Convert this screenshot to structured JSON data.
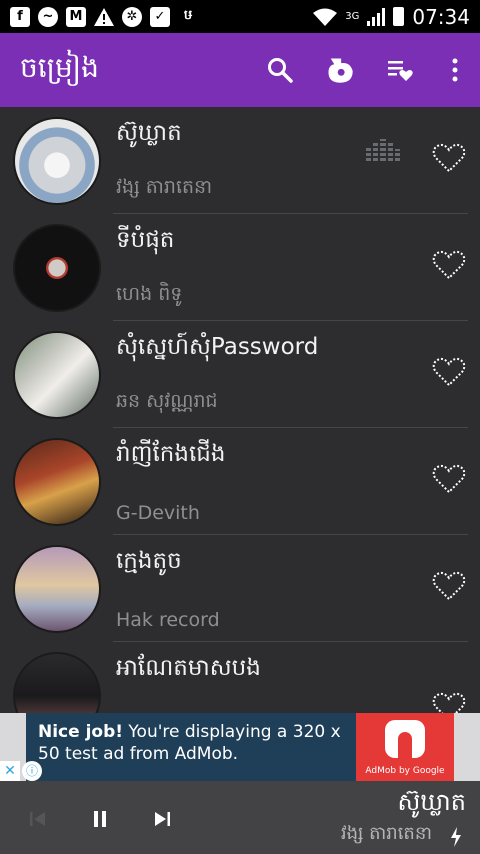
{
  "status_bar": {
    "network": "3G",
    "time": "07:34",
    "left_icons": [
      "facebook-icon",
      "messenger-icon",
      "gmail-icon",
      "warning-icon",
      "settings-icon",
      "inbox-icon",
      "vpn-icon"
    ]
  },
  "appbar": {
    "title": "ចម្រៀង",
    "color": "#7a2fb5",
    "icons": [
      "search-icon",
      "artist-icon",
      "playlist-favorite-icon",
      "more-vert-icon"
    ]
  },
  "songs": [
    {
      "title": "ស៊ូឃ្លាត",
      "artist": "វង្ស តារាតេនា",
      "playing": true
    },
    {
      "title": "ទីបំផុត",
      "artist": "ហេង ពិទូ",
      "playing": false
    },
    {
      "title": "សុំស្នេហ៍សុំPassword",
      "artist": "ឆន សុវណ្ណរាជ",
      "playing": false
    },
    {
      "title": "រាំញីកែងជើង",
      "artist": "G-Devith",
      "playing": false
    },
    {
      "title": "ក្មេងតូច",
      "artist": "Hak record",
      "playing": false
    },
    {
      "title": "អាណែតមាសបង",
      "artist": "",
      "playing": false
    }
  ],
  "ad": {
    "headline": "Nice job!",
    "body": " You're displaying a 320 x 50 test ad from AdMob.",
    "by": "AdMob by Google"
  },
  "now_playing": {
    "title": "ស៊ូឃ្លាត",
    "artist": "វង្ស តារាតេនា"
  }
}
